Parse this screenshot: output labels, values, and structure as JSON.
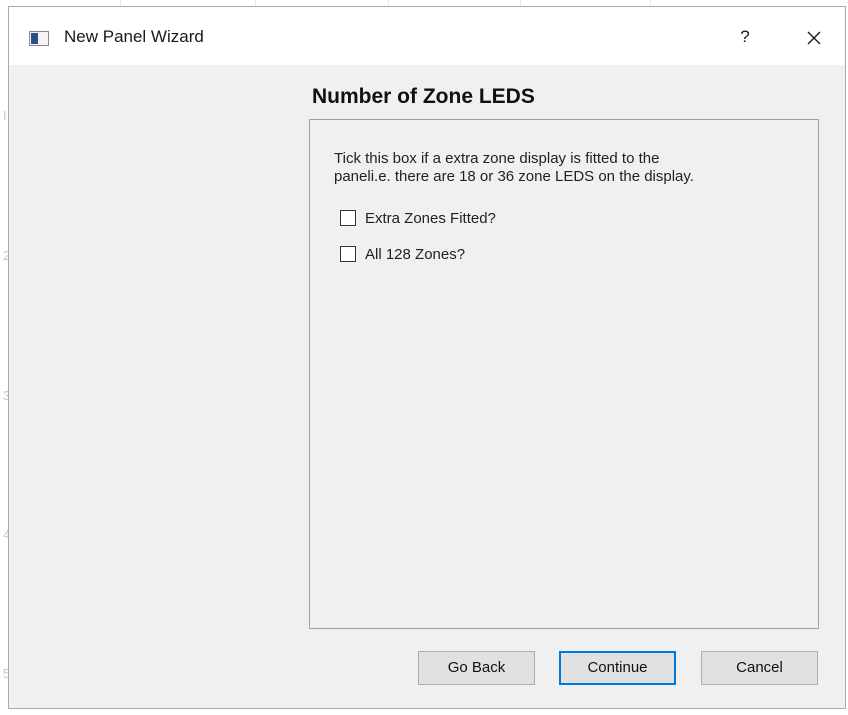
{
  "window": {
    "title": "New Panel Wizard",
    "help_label": "?",
    "close_icon": "close-icon"
  },
  "page": {
    "heading": "Number of Zone LEDS",
    "description": "Tick this box if a extra zone display is fitted to the\npaneli.e. there are 18 or 36 zone LEDS on the display."
  },
  "options": [
    {
      "label": "Extra Zones Fitted?",
      "checked": false
    },
    {
      "label": "All 128 Zones?",
      "checked": false
    }
  ],
  "buttons": {
    "back_label": "Go Back",
    "continue_label": "Continue",
    "cancel_label": "Cancel"
  },
  "background": {
    "ruler_marks": [
      "I",
      "2",
      "3",
      "4",
      "5"
    ]
  },
  "colors": {
    "dialog_bg": "#f0f0f0",
    "titlebar_bg": "#ffffff",
    "default_button_border": "#0078d7",
    "button_bg": "#e1e1e1"
  }
}
